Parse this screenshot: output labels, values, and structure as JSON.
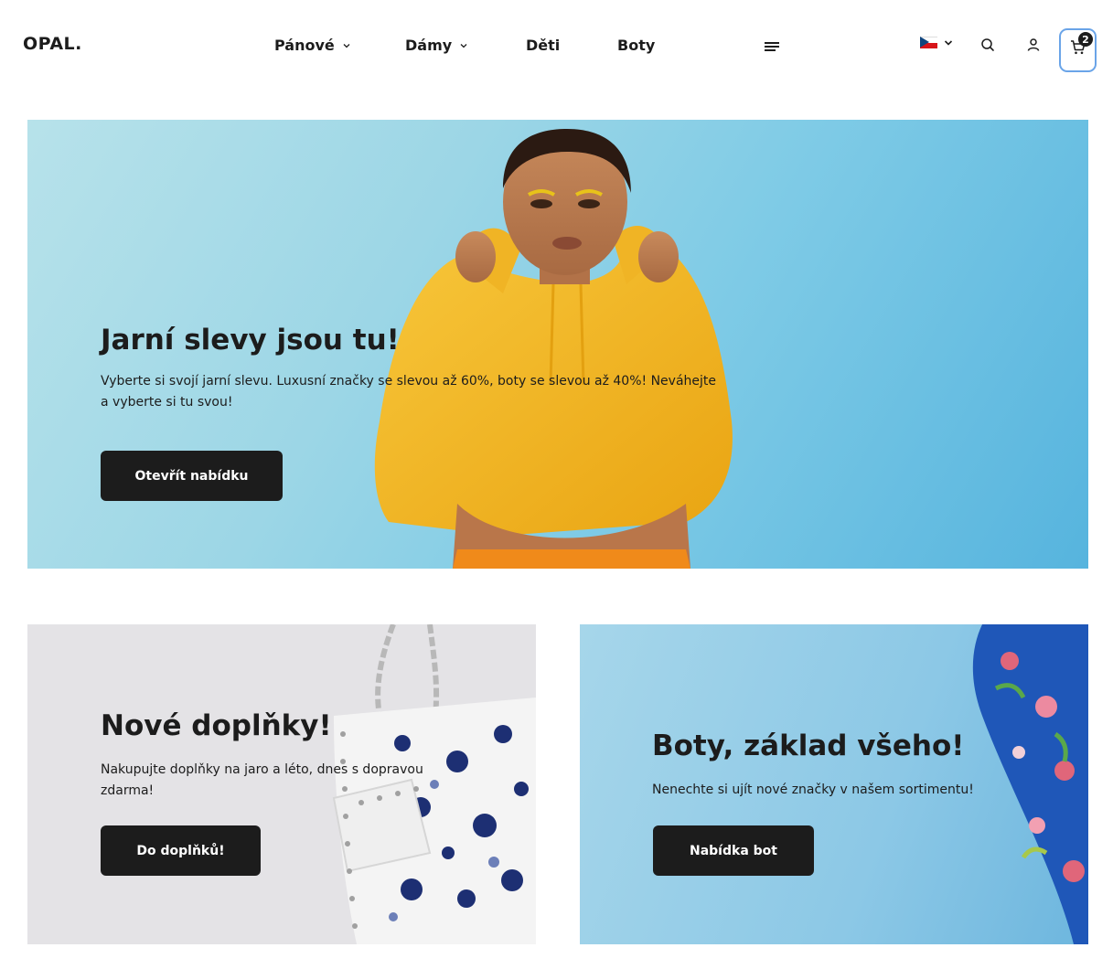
{
  "brand": {
    "logo": "OPAL."
  },
  "nav": {
    "items": [
      {
        "label": "Pánové",
        "has_dropdown": true
      },
      {
        "label": "Dámy",
        "has_dropdown": true
      },
      {
        "label": "Děti",
        "has_dropdown": false
      },
      {
        "label": "Boty",
        "has_dropdown": false
      }
    ],
    "menu_icon": "hamburger-icon"
  },
  "header_actions": {
    "language": {
      "flag": "czech-flag-icon",
      "dropdown_icon": "chevron-down-icon"
    },
    "search_icon": "search-icon",
    "account_icon": "user-icon",
    "cart": {
      "icon": "cart-icon",
      "count": "2"
    }
  },
  "hero": {
    "title": "Jarní slevy jsou tu!",
    "text": "Vyberte si svojí jarní slevu. Luxusní značky se slevou až 60%, boty se slevou až 40%! Neváhejte a vyberte si tu svou!",
    "button": "Otevřít nabídku"
  },
  "promo_left": {
    "title": "Nové doplňky!",
    "text": "Nakupujte doplňky na jaro a léto, dnes s dopravou zdarma!",
    "button": "Do doplňků!"
  },
  "promo_right": {
    "title": "Boty, základ všeho!",
    "text": "Nenechte si ujít nové značky v našem sortimentu!",
    "button": "Nabídka bot"
  },
  "colors": {
    "text": "#1c1c1c",
    "button_bg": "#1c1c1c",
    "button_text": "#ffffff",
    "cart_focus": "#6aa4e8",
    "hero_bg": "#7fcbe6",
    "hoodie": "#f2b41c",
    "card_left_bg": "#e4e3e6",
    "card_right_bg": "#8cc8e6"
  }
}
